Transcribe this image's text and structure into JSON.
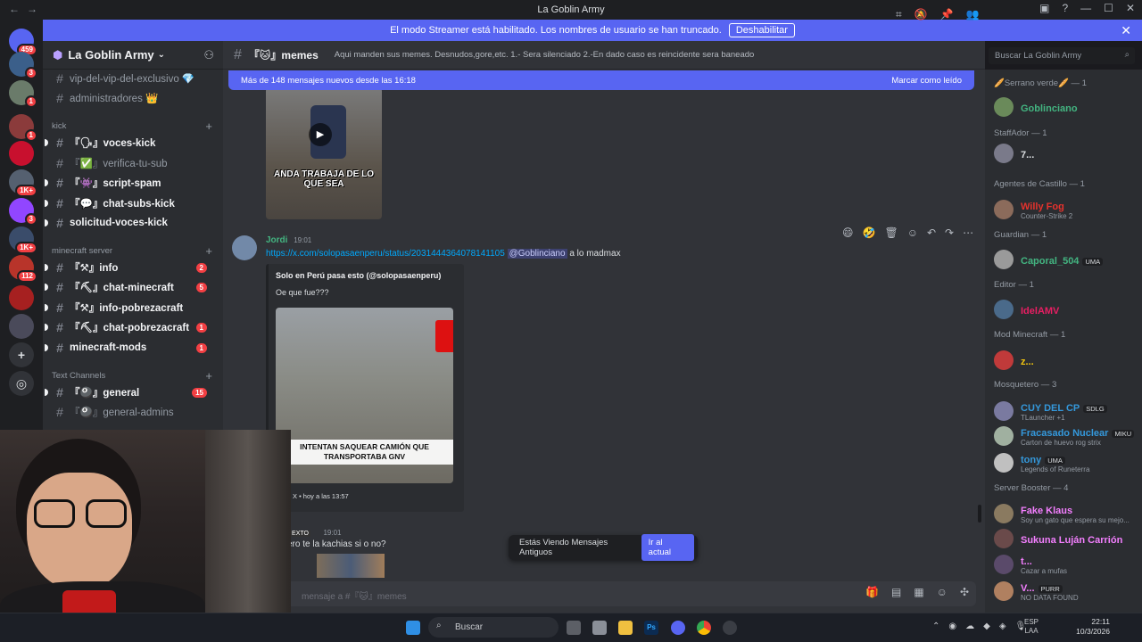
{
  "window": {
    "title": "La Goblin Army"
  },
  "banner": {
    "text": "El modo Streamer está habilitado. Los nombres de usuario se han truncado.",
    "button": "Deshabilitar"
  },
  "server": {
    "name": "La Goblin Army"
  },
  "guilds": [
    {
      "badge": "459",
      "color": "#5865f2"
    },
    {
      "badge": "3",
      "color": "#3b5f8a"
    },
    {
      "badge": "1",
      "color": "#6a7b6a"
    },
    {
      "badge": "1",
      "color": "#8b3b3b"
    },
    {
      "badge": "",
      "color": "#c8102e"
    },
    {
      "badge": "1K+",
      "color": "#556070"
    },
    {
      "badge": "3",
      "color": "#9146ff"
    },
    {
      "badge": "1K+",
      "color": "#3a4c6a"
    },
    {
      "badge": "112",
      "color": "#b8342a"
    },
    {
      "badge": "",
      "color": "#a62020"
    },
    {
      "badge": "",
      "color": "#4a4a5a"
    }
  ],
  "channels": [
    {
      "name": "vip-del-vip-del-exclusivo 💎",
      "prefix": "💎",
      "unread": false,
      "badge": ""
    },
    {
      "name": "administradores 👑",
      "prefix": "👑",
      "unread": false,
      "badge": ""
    }
  ],
  "cat_kick": "kick",
  "kick_channels": [
    {
      "name": "『🗣』voces-kick",
      "badge": ""
    },
    {
      "name": "『✅』verifica-tu-sub",
      "badge": ""
    },
    {
      "name": "『👾』script-spam",
      "badge": ""
    },
    {
      "name": "『💬』chat-subs-kick",
      "badge": ""
    },
    {
      "name": "solicitud-voces-kick",
      "badge": ""
    }
  ],
  "cat_mc": "minecraft server",
  "mc_channels": [
    {
      "name": "『⚒』info",
      "badge": "2"
    },
    {
      "name": "『⛏』chat-minecraft",
      "badge": "5"
    },
    {
      "name": "『⚒』info-pobrezacraft",
      "badge": ""
    },
    {
      "name": "『⛏』chat-pobrezacraft",
      "badge": "1"
    },
    {
      "name": "minecraft-mods",
      "badge": "1"
    }
  ],
  "cat_text": "Text Channels",
  "text_channels": [
    {
      "name": "『🎱』general",
      "badge": "15"
    },
    {
      "name": "『🎱』general-admins",
      "badge": ""
    }
  ],
  "header": {
    "channel": "『🐱』memes",
    "topic": "Aqui manden sus memes. Desnudos,gore,etc. 1.- Sera silenciado 2.-En dado caso es reincidente sera baneado",
    "search": "Buscar La Goblin Army"
  },
  "newbar": {
    "text": "Más de 148 mensajes nuevos desde las 16:18",
    "action": "Marcar como leído"
  },
  "video1": {
    "caption": "ANDA TRABAJA DE LO QUE SEA"
  },
  "msg1": {
    "author": "Jordi",
    "time": "19:01",
    "link": "https://x.com/solopasaenperu/status/2031444364078141105",
    "mention": "@Goblinciano",
    "text": "a lo madmax"
  },
  "embed": {
    "title": "Solo en Perú pasa esto (@solopasaenperu)",
    "desc": "Oe que fue???",
    "caption": "INTENTAN SAQUEAR CAMIÓN QUE TRANSPORTABA GNV",
    "footer": "X • hoy a las 13:57"
  },
  "msg2": {
    "author": "i",
    "tag": "EXTO",
    "time": "19:01",
    "text": "ero te la kachias si o no?"
  },
  "oldmsgs": {
    "text": "Estás Viendo Mensajes Antiguos",
    "button": "Ir al actual"
  },
  "composer": {
    "placeholder": "mensaje a #『🐱』memes"
  },
  "members": [
    {
      "cat": "🥖Serrano verde🥖 — 1",
      "name": "Goblinciano",
      "color": "#43b581",
      "activity": ""
    },
    {
      "cat": "StaffAdor — 1",
      "name": "7...",
      "color": "#dbdee1",
      "activity": ""
    },
    {
      "cat": "Agentes de Castillo — 1",
      "name": "Willy Fog",
      "color": "#e5322d",
      "activity": "Counter-Strike 2"
    },
    {
      "cat": "Guardian — 1",
      "name": "Caporal_504",
      "color": "#43b581",
      "activity": "",
      "tag": "UMA"
    },
    {
      "cat": "Editor — 1",
      "name": "IdelAMV",
      "color": "#e91e63",
      "activity": ""
    },
    {
      "cat": "Mod Minecraft — 1",
      "name": "z...",
      "color": "#f1c40f",
      "activity": ""
    },
    {
      "cat": "Mosquetero — 3",
      "name": "CUY DEL CP",
      "color": "#3498db",
      "activity": "TLauncher +1",
      "tag": "SDLG"
    },
    {
      "cat": "",
      "name": "Fracasado Nuclear",
      "color": "#3498db",
      "activity": "Carton de huevo rog strix",
      "tag": "MIKU"
    },
    {
      "cat": "",
      "name": "tony",
      "color": "#3498db",
      "activity": "Legends of Runeterra",
      "tag": "UMA"
    },
    {
      "cat": "Server Booster — 4",
      "name": "Fake Klaus",
      "color": "#f47fff",
      "activity": "Soy un gato que espera su mejo..."
    },
    {
      "cat": "",
      "name": "Sukuna Luján Carrión",
      "color": "#f47fff",
      "activity": ""
    },
    {
      "cat": "",
      "name": "t...",
      "color": "#f47fff",
      "activity": "Cazar a mufas"
    },
    {
      "cat": "",
      "name": "V...",
      "color": "#f47fff",
      "activity": "NO DATA FOUND",
      "tag": "PURR"
    }
  ],
  "taskbar": {
    "search": "Buscar",
    "lang1": "ESP",
    "lang2": "LAA",
    "time": "22:11",
    "date": "10/3/2026"
  }
}
